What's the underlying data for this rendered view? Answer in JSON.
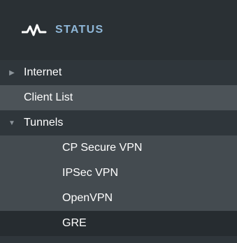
{
  "header": {
    "title": "STATUS",
    "icon": "pulse-icon",
    "accent_color": "#8fb7d8"
  },
  "menu": {
    "internet": {
      "label": "Internet",
      "icon": "caret-right-icon"
    },
    "client_list": {
      "label": "Client List"
    },
    "tunnels": {
      "label": "Tunnels",
      "icon": "caret-down-icon",
      "children": [
        {
          "label": "CP Secure VPN"
        },
        {
          "label": "IPSec VPN"
        },
        {
          "label": "OpenVPN"
        },
        {
          "label": "GRE"
        }
      ]
    }
  }
}
